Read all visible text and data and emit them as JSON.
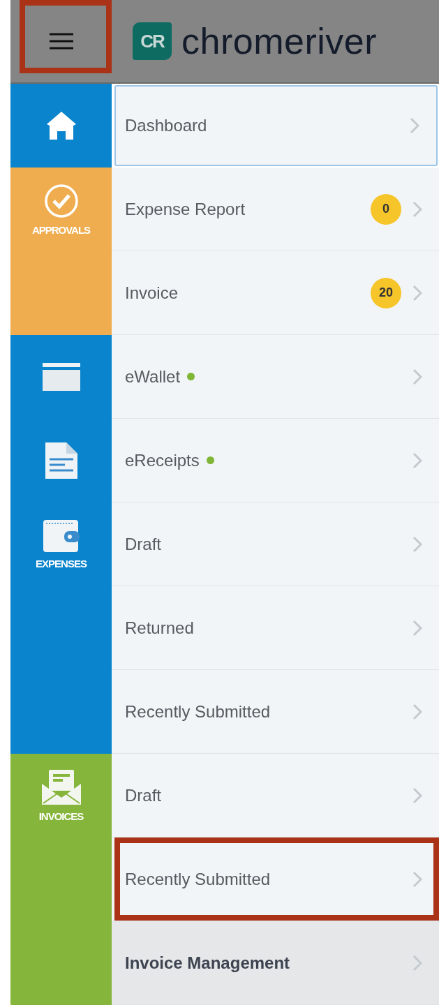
{
  "header": {
    "menu_button": {
      "highlighted": true
    },
    "logo": {
      "mark": "CR",
      "text": "chromeriver"
    }
  },
  "sections": [
    {
      "color": "#0a84cc",
      "icons": [
        {
          "kind": "home"
        }
      ],
      "items": [
        {
          "label": "Dashboard",
          "selected": true,
          "highlighted": false,
          "new": false
        }
      ]
    },
    {
      "color": "#efad4f",
      "label": "APPROVALS",
      "icons": [
        {
          "kind": "check"
        }
      ],
      "items": [
        {
          "label": "Expense Report",
          "badge": "0",
          "selected": false,
          "highlighted": false,
          "new": false
        },
        {
          "label": "Invoice",
          "badge": "20",
          "selected": false,
          "highlighted": false,
          "new": false
        }
      ]
    },
    {
      "color": "#0a84cc",
      "label": "EXPENSES",
      "icons": [
        {
          "kind": "card"
        },
        {
          "kind": "document"
        },
        {
          "kind": "wallet"
        }
      ],
      "items": [
        {
          "label": "eWallet",
          "selected": false,
          "highlighted": false,
          "new": true
        },
        {
          "label": "eReceipts",
          "selected": false,
          "highlighted": false,
          "new": true
        },
        {
          "label": "Draft",
          "selected": false,
          "highlighted": false,
          "new": false
        },
        {
          "label": "Returned",
          "selected": false,
          "highlighted": false,
          "new": false
        },
        {
          "label": "Recently Submitted",
          "selected": false,
          "highlighted": false,
          "new": false
        }
      ]
    },
    {
      "color": "#86b53b",
      "label": "INVOICES",
      "icons": [
        {
          "kind": "envelope"
        }
      ],
      "items": [
        {
          "label": "Draft",
          "selected": false,
          "highlighted": false,
          "new": false
        },
        {
          "label": "Recently Submitted",
          "selected": false,
          "highlighted": true,
          "new": false
        },
        {
          "label": "Invoice Management",
          "kind": "group",
          "selected": false,
          "highlighted": false,
          "new": false
        }
      ]
    }
  ]
}
